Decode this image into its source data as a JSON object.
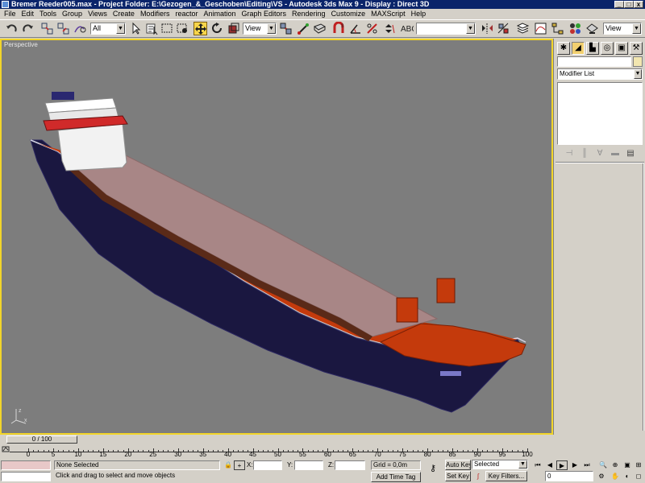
{
  "window": {
    "title": "Bremer Reeder005.max     - Project Folder: E:\\Gezogen_&_Geschoben\\Editing\\VS     - Autodesk 3ds Max 9     - Display : Direct 3D",
    "minimize": "_",
    "maximize": "□",
    "close": "x"
  },
  "menu": [
    "File",
    "Edit",
    "Tools",
    "Group",
    "Views",
    "Create",
    "Modifiers",
    "reactor",
    "Animation",
    "Graph Editors",
    "Rendering",
    "Customize",
    "MAXScript",
    "Help"
  ],
  "toolbar": {
    "selection_filter": "All",
    "reference_coord": "View",
    "named_selection": "",
    "view_combo": "View"
  },
  "viewport": {
    "label": "Perspective",
    "background": "#7d7d7d",
    "border_color": "#f2d52a"
  },
  "command_panel": {
    "object_name": "",
    "modifier_list": "Modifier List"
  },
  "timeline": {
    "slider_text": "0 / 100",
    "ticks": [
      "0",
      "5",
      "10",
      "15",
      "20",
      "25",
      "30",
      "35",
      "40",
      "45",
      "50",
      "55",
      "60",
      "65",
      "70",
      "75",
      "80",
      "85",
      "90",
      "95",
      "100"
    ]
  },
  "status": {
    "selection": "None Selected",
    "prompt": "Click and drag to select and move objects",
    "x_label": "X:",
    "y_label": "Y:",
    "z_label": "Z:",
    "x_value": "",
    "y_value": "",
    "z_value": "",
    "grid": "Grid = 0,0m",
    "add_time_tag": "Add Time Tag",
    "auto_key": "Auto Key",
    "set_key": "Set Key",
    "key_mode": "Selected",
    "key_filters": "Key Filters...",
    "current_frame": "0"
  },
  "colors": {
    "ui": "#d4d0c8",
    "titlebar": "#0a246a",
    "hull": "#1a1740",
    "deck_interior": "#c43a0c",
    "hatch_cover": "#a88686",
    "superstructure": "#f2f2f2"
  }
}
